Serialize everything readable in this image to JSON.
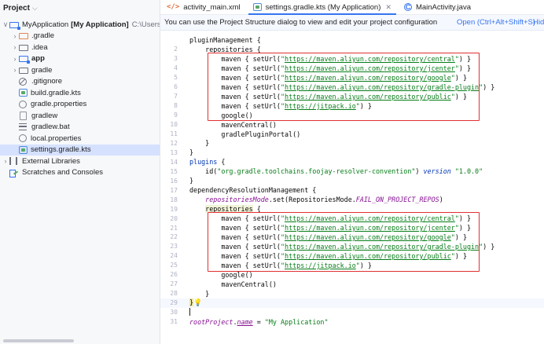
{
  "project_panel": {
    "title": "Project",
    "tree": [
      {
        "arrow": "∨",
        "icon": "module-folder-icon",
        "label": "MyApplication",
        "bold_suffix": "[My Application]",
        "path": "C:\\Users\\Administr",
        "indent": 0
      },
      {
        "arrow": "›",
        "icon": "folder-orange-icon",
        "label": ".gradle",
        "indent": 1
      },
      {
        "arrow": "›",
        "icon": "folder-icon",
        "label": ".idea",
        "indent": 1
      },
      {
        "arrow": "›",
        "icon": "module-icon",
        "label": "app",
        "bold": true,
        "indent": 1
      },
      {
        "arrow": "›",
        "icon": "folder-icon",
        "label": "gradle",
        "indent": 1
      },
      {
        "arrow": "",
        "icon": "gitignore-icon",
        "label": ".gitignore",
        "indent": 1
      },
      {
        "arrow": "",
        "icon": "kotlin-script-icon",
        "label": "build.gradle.kts",
        "indent": 1
      },
      {
        "arrow": "",
        "icon": "properties-icon",
        "label": "gradle.properties",
        "indent": 1
      },
      {
        "arrow": "",
        "icon": "script-icon",
        "label": "gradlew",
        "indent": 1
      },
      {
        "arrow": "",
        "icon": "text-file-icon",
        "label": "gradlew.bat",
        "indent": 1
      },
      {
        "arrow": "",
        "icon": "properties-icon",
        "label": "local.properties",
        "indent": 1
      },
      {
        "arrow": "",
        "icon": "kotlin-script-icon",
        "label": "settings.gradle.kts",
        "indent": 1,
        "selected": true
      },
      {
        "arrow": "›",
        "icon": "library-icon",
        "label": "External Libraries",
        "indent": 0
      },
      {
        "arrow": "",
        "icon": "scratch-icon",
        "label": "Scratches and Consoles",
        "indent": 0
      }
    ]
  },
  "tabs": [
    {
      "label": "activity_main.xml",
      "icon": "xml-icon",
      "active": false
    },
    {
      "label": "settings.gradle.kts (My Application)",
      "icon": "kotlin-script-icon",
      "active": true,
      "closable": true
    },
    {
      "label": "MainActivity.java",
      "icon": "class-icon",
      "active": false
    }
  ],
  "notice": {
    "text": "You can use the Project Structure dialog to view and edit your project configuration",
    "action": "Open (Ctrl+Alt+Shift+S)",
    "hide": "Hide"
  },
  "code": {
    "line_numbers": [
      "2",
      "3",
      "4",
      "5",
      "6",
      "7",
      "8",
      "9",
      "10",
      "11",
      "12",
      "13",
      "14",
      "15",
      "16",
      "17",
      "18",
      "19",
      "20",
      "21",
      "22",
      "23",
      "24",
      "25",
      "26",
      "27",
      "28",
      "29",
      "30",
      "31"
    ],
    "maven_urls_1": [
      "https://maven.aliyun.com/repository/central",
      "https://maven.aliyun.com/repository/jcenter",
      "https://maven.aliyun.com/repository/google",
      "https://maven.aliyun.com/repository/gradle-plugin",
      "https://maven.aliyun.com/repository/public",
      "https://jitpack.io"
    ],
    "maven_urls_2": [
      "https://maven.aliyun.com/repository/central",
      "https://maven.aliyun.com/repository/jcenter",
      "https://maven.aliyun.com/repository/google",
      "https://maven.aliyun.com/repository/gradle-plugin",
      "https://maven.aliyun.com/repository/public",
      "https://jitpack.io"
    ],
    "plugin_id": "org.gradle.toolchains.foojay-resolver-convention",
    "plugin_version": "1.0.0",
    "root_project_name": "My Application",
    "highlight_color": "#e03131"
  }
}
